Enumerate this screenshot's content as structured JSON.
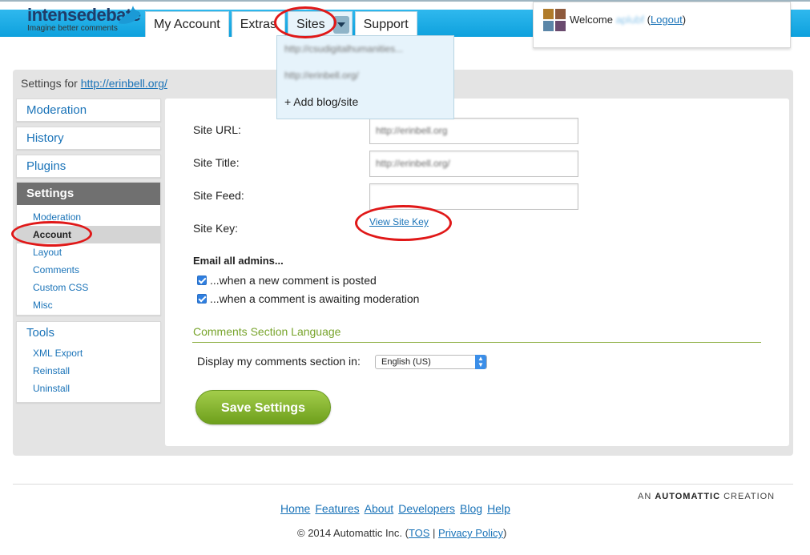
{
  "logo": {
    "brand_part1": "intense",
    "brand_part2": "debate",
    "tagline": "Imagine better comments"
  },
  "nav": {
    "tabs": [
      "My Account",
      "Extras",
      "Sites",
      "Support"
    ]
  },
  "sites_menu": {
    "items": [
      "http://csudigitalhumanities...",
      "http://erinbell.org/"
    ],
    "add_label": "+ Add blog/site"
  },
  "welcome": {
    "prefix": "Welcome ",
    "username": "aplubf",
    "logout_open": " (",
    "logout": "Logout",
    "logout_close": ")"
  },
  "breadcrumb": {
    "prefix": "Settings for ",
    "site_link": "http://erinbell.org/"
  },
  "sidebar": {
    "moderation": "Moderation",
    "history": "History",
    "plugins": "Plugins",
    "settings": "Settings",
    "settings_items": [
      "Moderation",
      "Account",
      "Layout",
      "Comments",
      "Custom CSS",
      "Misc"
    ],
    "tools": "Tools",
    "tools_items": [
      "XML Export",
      "Reinstall",
      "Uninstall"
    ]
  },
  "form": {
    "site_url_label": "Site URL:",
    "site_url_value": "http://erinbell.org",
    "site_title_label": "Site Title:",
    "site_title_value": "http://erinbell.org/",
    "site_feed_label": "Site Feed:",
    "site_feed_value": "",
    "site_key_label": "Site Key:",
    "view_site_key": "View Site Key",
    "email_title": "Email all admins...",
    "email_opt1": "...when a new comment is posted",
    "email_opt2": "...when a comment is awaiting moderation",
    "email_opt1_checked": true,
    "email_opt2_checked": true,
    "lang_section": "Comments Section Language",
    "display_label": "Display my comments section in:",
    "language_selected": "English (US)",
    "save_button": "Save Settings"
  },
  "footer": {
    "automattic_prefix": "AN ",
    "automattic_brand": "AUTOMATTIC",
    "automattic_suffix": " CREATION",
    "links": [
      "Home",
      "Features",
      "About",
      "Developers",
      "Blog",
      "Help"
    ],
    "copyright": "© 2014 Automattic Inc. (",
    "tos": "TOS",
    "sep": " | ",
    "privacy": "Privacy Policy",
    "close": ")"
  },
  "colors": {
    "brand_blue": "#0ea1dd",
    "link": "#1a73b8",
    "save_green": "#7aab25",
    "annotation_red": "#e01818"
  },
  "avatar_colors": [
    "#b07b2a",
    "#8e5a3c",
    "#5b86a8",
    "#6a4a6e"
  ]
}
